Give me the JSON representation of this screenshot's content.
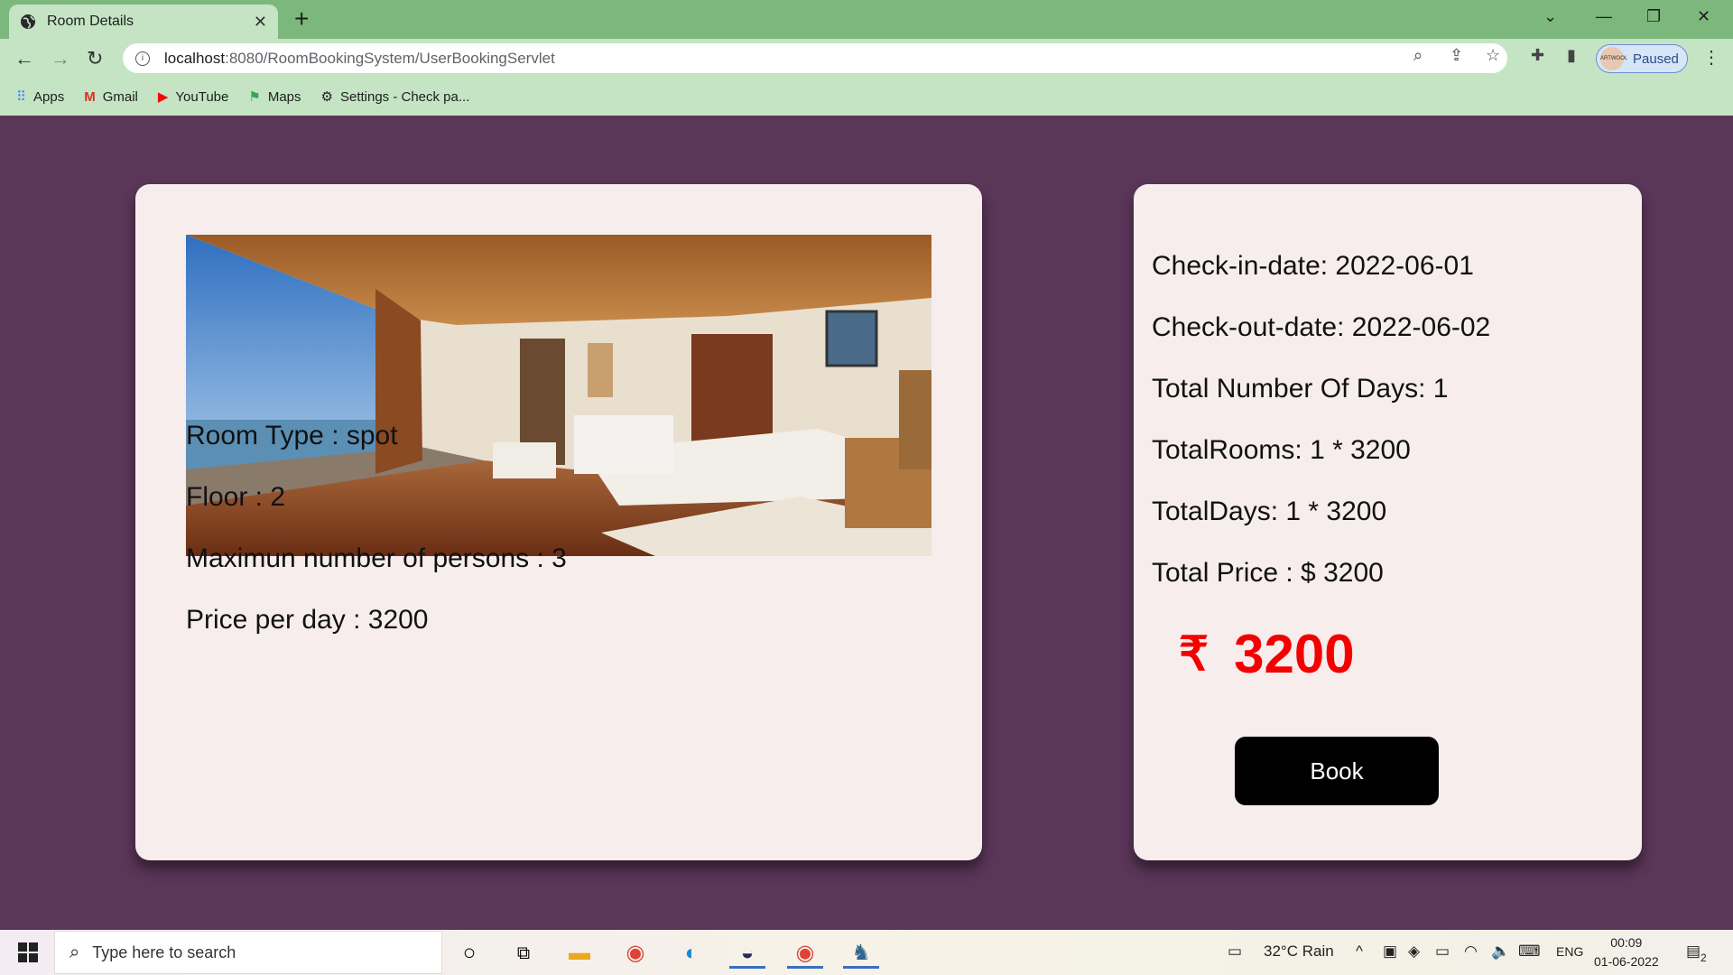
{
  "browser": {
    "tab_title": "Room Details",
    "url_host": "localhost",
    "url_path": ":8080/RoomBookingSystem/UserBookingServlet",
    "profile_label": "Paused",
    "profile_avatar_text": "ARTWOOL",
    "bookmarks": [
      {
        "label": "Apps",
        "icon": "apps-grid-icon"
      },
      {
        "label": "Gmail",
        "icon": "gmail-icon"
      },
      {
        "label": "YouTube",
        "icon": "youtube-icon"
      },
      {
        "label": "Maps",
        "icon": "maps-icon"
      },
      {
        "label": "Settings - Check pa...",
        "icon": "gear-icon"
      }
    ]
  },
  "room": {
    "type_line": "Room Type : spot",
    "floor_line": "Floor : 2",
    "persons_line": "Maximun number of persons : 3",
    "price_line": "Price per day : 3200"
  },
  "booking": {
    "checkin_line": "Check-in-date: 2022-06-01",
    "checkout_line": "Check-out-date: 2022-06-02",
    "days_line": "Total Number Of Days: 1",
    "rooms_line": "TotalRooms: 1 * 3200",
    "totaldays_line": "TotalDays: 1 * 3200",
    "total_price_line": "Total Price : $ 3200",
    "currency_symbol": "₹",
    "amount": "3200",
    "book_label": "Book"
  },
  "taskbar": {
    "search_placeholder": "Type here to search",
    "weather": "32°C  Rain",
    "language": "ENG",
    "time": "00:09",
    "date": "01-06-2022",
    "notification_count": "2"
  },
  "colors": {
    "page_background": "#5a3658",
    "card_background": "#f7eded",
    "price_accent": "#f40000",
    "button_background": "#000000"
  }
}
